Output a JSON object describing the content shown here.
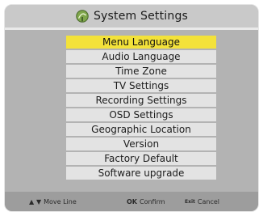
{
  "title": {
    "icon": "satellite-dish-icon",
    "text": "System Settings"
  },
  "menu": {
    "items": [
      {
        "label": "Menu Language",
        "selected": true
      },
      {
        "label": "Audio Language"
      },
      {
        "label": "Time Zone"
      },
      {
        "label": "TV Settings"
      },
      {
        "label": "Recording Settings"
      },
      {
        "label": "OSD Settings"
      },
      {
        "label": "Geographic Location"
      },
      {
        "label": "Version"
      },
      {
        "label": "Factory Default"
      },
      {
        "label": "Software upgrade"
      }
    ]
  },
  "help": {
    "move_key": "▲ ▼",
    "move_label": "Move Line",
    "ok_key": "OK",
    "ok_label": "Confirm",
    "exit_key": "Exit",
    "exit_label": "Cancel"
  },
  "colors": {
    "selected": "#f3e23a",
    "item": "#e3e3e3",
    "background": "#b3b3b3"
  }
}
